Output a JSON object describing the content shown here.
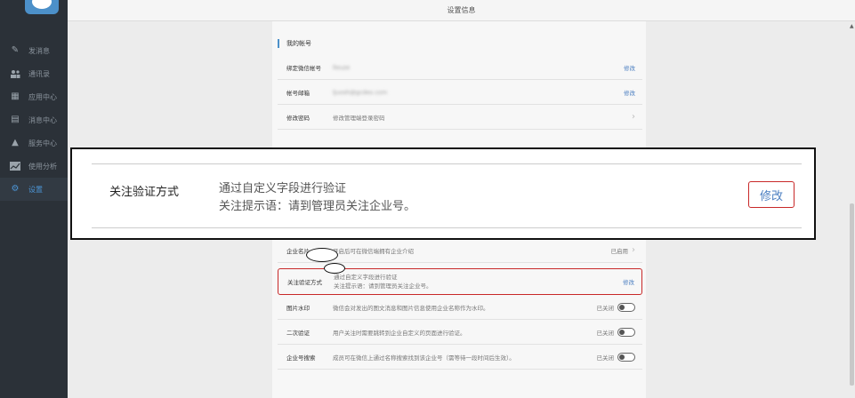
{
  "header": {
    "title": "设置信息"
  },
  "sidebar": {
    "items": [
      {
        "label": "发消息",
        "icon": "✎"
      },
      {
        "label": "通讯录",
        "icon": "👥"
      },
      {
        "label": "应用中心",
        "icon": "▦"
      },
      {
        "label": "消息中心",
        "icon": "▤"
      },
      {
        "label": "服务中心",
        "icon": "▲"
      },
      {
        "label": "使用分析",
        "icon": "📈"
      },
      {
        "label": "设置",
        "icon": "⚙"
      }
    ]
  },
  "account": {
    "section_title": "我的帐号",
    "rows": [
      {
        "label": "绑定微信帐号",
        "value": "lleuze",
        "action": "修改"
      },
      {
        "label": "帐号邮箱",
        "value": "ljuosh@gcdex.com",
        "action": "修改"
      },
      {
        "label": "修改密码",
        "value": "修改管理端登录密码",
        "action": ""
      }
    ]
  },
  "settings": {
    "rows": [
      {
        "label": "企业名片",
        "value": "开启后可在微信端拥有企业介绍",
        "state": "已启用"
      },
      {
        "label": "关注验证方式",
        "value_line1": "通过自定义字段进行验证",
        "value_line2": "关注提示语：请到管理员关注企业号。",
        "action": "修改"
      },
      {
        "label": "图片水印",
        "value": "微信会对发出的图文消息和图片信息使用企业名称作为水印。",
        "state": "已关闭"
      },
      {
        "label": "二次验证",
        "value": "用户关注时需要跳转到企业自定义的页面进行验证。",
        "state": "已关闭"
      },
      {
        "label": "企业号搜索",
        "value": "成员可在微信上通过名称搜索找到该企业号（需等待一段时间后生效）。",
        "state": "已关闭"
      }
    ]
  },
  "zoom": {
    "label": "关注验证方式",
    "value_line1": "通过自定义字段进行验证",
    "value_line2": "关注提示语：请到管理员关注企业号。",
    "action": "修改"
  },
  "colors": {
    "accent": "#4c90c9",
    "highlight_border": "#c82828",
    "sidebar_bg": "#2b3138"
  }
}
